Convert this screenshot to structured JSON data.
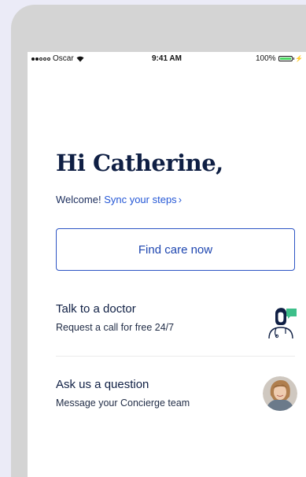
{
  "status_bar": {
    "carrier": "Oscar",
    "time": "9:41 AM",
    "battery_text": "100%",
    "battery_level": 1.0
  },
  "greeting": {
    "title": "Hi Catherine,",
    "welcome": "Welcome!",
    "sync_link": "Sync your steps"
  },
  "find_care": {
    "label": "Find care now"
  },
  "items": [
    {
      "title": "Talk to a doctor",
      "subtitle": "Request a call for free 24/7",
      "icon": "doctor-chat-icon"
    },
    {
      "title": "Ask us a question",
      "subtitle": "Message your Concierge team",
      "icon": "concierge-avatar"
    }
  ],
  "colors": {
    "navy": "#0f1f44",
    "accent_blue": "#2457d6",
    "button_blue": "#2c54c4",
    "chat_green": "#3dbf8a",
    "battery_green": "#4cd964",
    "page_background": "#ebebf7"
  }
}
